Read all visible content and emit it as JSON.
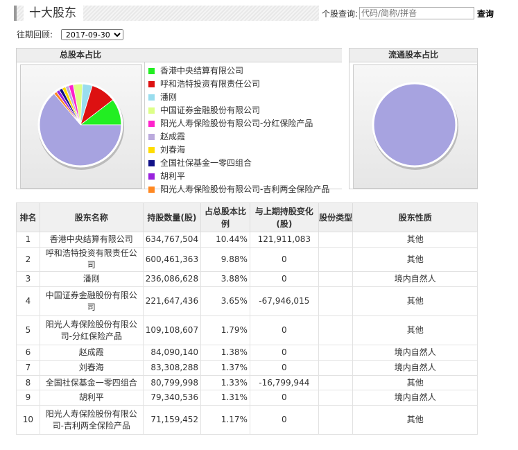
{
  "header": {
    "title": "十大股东",
    "search_label": "个股查询:",
    "search_placeholder": "代码/简称/拼音",
    "search_button": "查询"
  },
  "period": {
    "label": "往期回顾:",
    "selected": "2017-09-30"
  },
  "panels": {
    "total_title": "总股本占比",
    "float_title": "流通股本占比"
  },
  "table": {
    "headers": [
      "排名",
      "股东名称",
      "持股数量(股)",
      "占总股本比例",
      "与上期持股变化(股)",
      "股份类型",
      "股东性质"
    ],
    "rows": [
      {
        "rank": "1",
        "name": "香港中央结算有限公司",
        "shares": "634,767,504",
        "ratio": "10.44%",
        "change": "121,911,083",
        "type": "",
        "nature": "其他"
      },
      {
        "rank": "2",
        "name": "呼和浩特投资有限责任公司",
        "shares": "600,461,363",
        "ratio": "9.88%",
        "change": "0",
        "type": "",
        "nature": "其他"
      },
      {
        "rank": "3",
        "name": "潘刚",
        "shares": "236,086,628",
        "ratio": "3.88%",
        "change": "0",
        "type": "",
        "nature": "境内自然人"
      },
      {
        "rank": "4",
        "name": "中国证券金融股份有限公司",
        "shares": "221,647,436",
        "ratio": "3.65%",
        "change": "-67,946,015",
        "type": "",
        "nature": "其他"
      },
      {
        "rank": "5",
        "name": "阳光人寿保险股份有限公司-分红保险产品",
        "shares": "109,108,607",
        "ratio": "1.79%",
        "change": "0",
        "type": "",
        "nature": "其他"
      },
      {
        "rank": "6",
        "name": "赵成霞",
        "shares": "84,090,140",
        "ratio": "1.38%",
        "change": "0",
        "type": "",
        "nature": "境内自然人"
      },
      {
        "rank": "7",
        "name": "刘春海",
        "shares": "83,308,288",
        "ratio": "1.37%",
        "change": "0",
        "type": "",
        "nature": "境内自然人"
      },
      {
        "rank": "8",
        "name": "全国社保基金一零四组合",
        "shares": "80,799,998",
        "ratio": "1.33%",
        "change": "-16,799,944",
        "type": "",
        "nature": "其他"
      },
      {
        "rank": "9",
        "name": "胡利平",
        "shares": "79,340,536",
        "ratio": "1.31%",
        "change": "0",
        "type": "",
        "nature": "境内自然人"
      },
      {
        "rank": "10",
        "name": "阳光人寿保险股份有限公司-吉利两全保险产品",
        "shares": "71,159,452",
        "ratio": "1.17%",
        "change": "0",
        "type": "",
        "nature": "其他"
      }
    ]
  },
  "chart_data": [
    {
      "type": "pie",
      "title": "总股本占比",
      "categories": [
        "香港中央结算有限公司",
        "呼和浩特投资有限责任公司",
        "潘刚",
        "中国证券金融股份有限公司",
        "阳光人寿保险股份有限公司-分红保险产品",
        "赵成霞",
        "刘春海",
        "全国社保基金一零四组合",
        "胡利平",
        "阳光人寿保险股份有限公司-吉利两全保险产品"
      ],
      "values": [
        10.44,
        9.88,
        3.88,
        3.65,
        1.79,
        1.38,
        1.37,
        1.33,
        1.31,
        1.17
      ],
      "colors": [
        "#22ee22",
        "#dd1111",
        "#99ddee",
        "#ddff88",
        "#ff22cc",
        "#bbaadd",
        "#ffdd00",
        "#111188",
        "#9922dd",
        "#ff8822"
      ],
      "other_color": "#a7a3e0"
    },
    {
      "type": "pie",
      "title": "流通股本占比",
      "values": [
        100
      ],
      "colors": [
        "#a7a3e0"
      ]
    }
  ]
}
